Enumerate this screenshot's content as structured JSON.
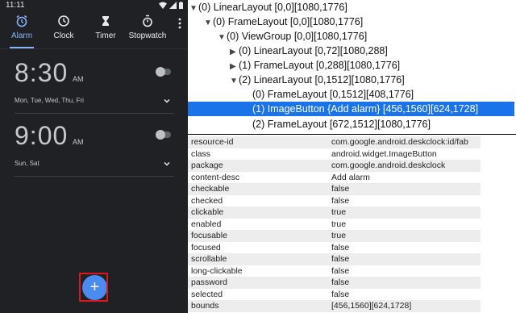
{
  "status": {
    "time": "11:11"
  },
  "tabs": [
    {
      "label": "Alarm",
      "icon": "alarm-clock-icon",
      "active": true
    },
    {
      "label": "Clock",
      "icon": "clock-icon",
      "active": false
    },
    {
      "label": "Timer",
      "icon": "hourglass-icon",
      "active": false
    },
    {
      "label": "Stopwatch",
      "icon": "stopwatch-icon",
      "active": false
    }
  ],
  "alarms": [
    {
      "time": "8:30",
      "ampm": "AM",
      "days": "Mon, Tue, Wed, Thu, Fri",
      "enabled": false
    },
    {
      "time": "9:00",
      "ampm": "AM",
      "days": "Sun, Sat",
      "enabled": false
    }
  ],
  "fab": {
    "glyph": "+",
    "content_desc": "Add alarm"
  },
  "tree": [
    {
      "arrow": "▼",
      "text": "(0) LinearLayout [0,0][1080,1776]"
    },
    {
      "arrow": "▼",
      "text": "(0) FrameLayout [0,0][1080,1776]"
    },
    {
      "arrow": "▼",
      "text": "(0) ViewGroup [0,0][1080,1776]"
    },
    {
      "arrow": "▶",
      "text": "(0) LinearLayout [0,72][1080,288]"
    },
    {
      "arrow": "▶",
      "text": "(1) FrameLayout [0,288][1080,1776]"
    },
    {
      "arrow": "▼",
      "text": "(2) LinearLayout [0,1512][1080,1776]"
    },
    {
      "arrow": "",
      "text": "(0) FrameLayout [0,1512][408,1776]"
    },
    {
      "arrow": "",
      "text": "(1) ImageButton {Add alarm} [456,1560][624,1728]",
      "selected": true
    },
    {
      "arrow": "",
      "text": "(2) FrameLayout [672,1512][1080,1776]"
    }
  ],
  "properties": [
    {
      "key": "resource-id",
      "value": "com.google.android.deskclock:id/fab"
    },
    {
      "key": "class",
      "value": "android.widget.ImageButton"
    },
    {
      "key": "package",
      "value": "com.google.android.deskclock"
    },
    {
      "key": "content-desc",
      "value": "Add alarm"
    },
    {
      "key": "checkable",
      "value": "false"
    },
    {
      "key": "checked",
      "value": "false"
    },
    {
      "key": "clickable",
      "value": "true"
    },
    {
      "key": "enabled",
      "value": "true"
    },
    {
      "key": "focusable",
      "value": "true"
    },
    {
      "key": "focused",
      "value": "false"
    },
    {
      "key": "scrollable",
      "value": "false"
    },
    {
      "key": "long-clickable",
      "value": "false"
    },
    {
      "key": "password",
      "value": "false"
    },
    {
      "key": "selected",
      "value": "false"
    },
    {
      "key": "bounds",
      "value": "[456,1560][624,1728]"
    }
  ],
  "colors": {
    "accent": "#8ab4f8",
    "fab": "#4a8bf0",
    "selection": "#1a73e8",
    "highlight": "#e0161b",
    "phone_bg": "#202124"
  }
}
